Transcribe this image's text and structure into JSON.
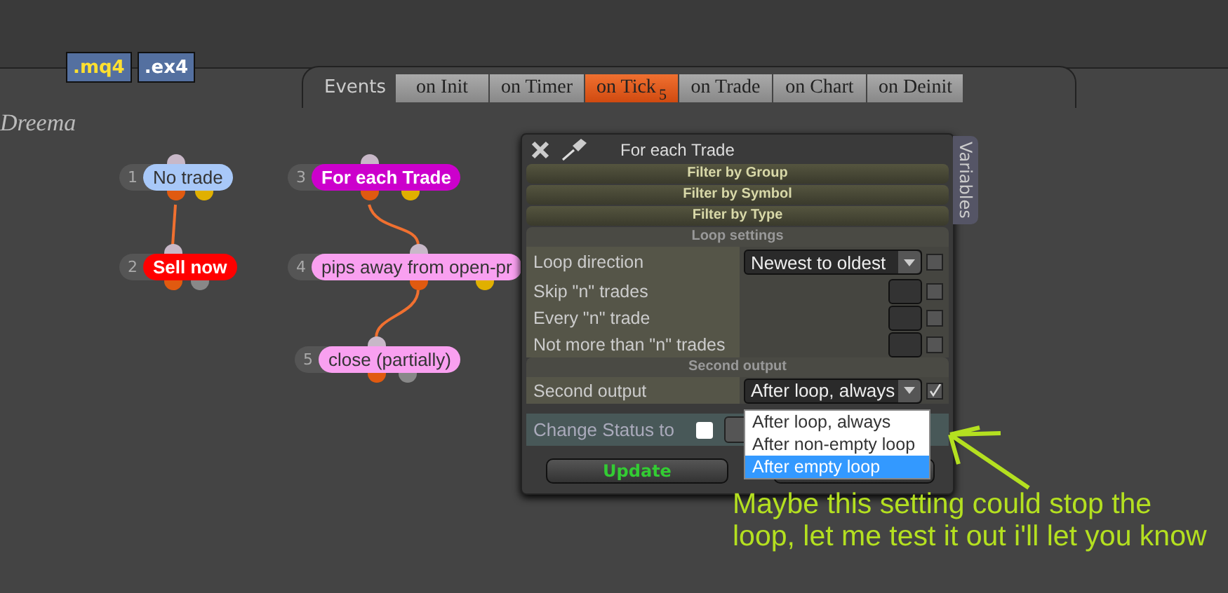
{
  "toolbar": {
    "buttons": [
      {
        "label": ".mq4"
      },
      {
        "label": ".ex4"
      }
    ]
  },
  "events": {
    "label": "Events",
    "tabs": [
      {
        "label": "on Init",
        "selected": false
      },
      {
        "label": "on Timer",
        "selected": false
      },
      {
        "label": "on Tick",
        "badge": "5",
        "selected": true
      },
      {
        "label": "on Trade",
        "selected": false
      },
      {
        "label": "on Chart",
        "selected": false
      },
      {
        "label": "on Deinit",
        "selected": false
      }
    ]
  },
  "logo": "Dreema",
  "nodes": [
    {
      "number": "1",
      "label": "No trade",
      "color": "#a8c8f8",
      "emphasis": false,
      "outputs": [
        {
          "color": "#e05a10"
        },
        {
          "color": "#e0b000"
        }
      ]
    },
    {
      "number": "2",
      "label": "Sell now",
      "color": "#ff0000",
      "emphasis": true,
      "outputs": [
        {
          "color": "#e05a10"
        },
        {
          "color": "#888888"
        }
      ]
    },
    {
      "number": "3",
      "label": "For each Trade",
      "color": "#cc00cc",
      "emphasis": true,
      "outputs": [
        {
          "color": "#e05a10"
        },
        {
          "color": "#e0b000"
        }
      ]
    },
    {
      "number": "4",
      "label": "pips away from open-pr",
      "color": "#f9a0f0",
      "emphasis": false,
      "outputs": [
        {
          "color": "#e05a10"
        },
        {
          "color": "#e0b000"
        }
      ]
    },
    {
      "number": "5",
      "label": "close (partially)",
      "color": "#f9a0f0",
      "emphasis": false,
      "outputs": [
        {
          "color": "#e05a10"
        },
        {
          "color": "#888888"
        }
      ]
    }
  ],
  "dialog": {
    "title": "For each Trade",
    "side_tab": "Variables",
    "filters": [
      "Filter by Group",
      "Filter by Symbol",
      "Filter by Type"
    ],
    "sections": [
      {
        "heading": "Loop settings",
        "rows": [
          {
            "label": "Loop direction",
            "kind": "select",
            "value": "Newest to oldest",
            "checked": false
          },
          {
            "label": "Skip \"n\" trades",
            "kind": "input",
            "checked": false
          },
          {
            "label": "Every \"n\" trade",
            "kind": "input",
            "checked": false
          },
          {
            "label": "Not more than \"n\" trades",
            "kind": "input",
            "checked": false
          }
        ]
      },
      {
        "heading": "Second output",
        "rows": [
          {
            "label": "Second output",
            "kind": "select",
            "value": "After loop, always",
            "checked": true
          }
        ]
      }
    ],
    "status": {
      "label": "Change Status to",
      "checked": false
    },
    "buttons": [
      {
        "label": "Update",
        "kind": "ok"
      },
      {
        "kind": "cancel"
      }
    ],
    "dropdown": {
      "options": [
        {
          "label": "After loop, always",
          "selected": false
        },
        {
          "label": "After non-empty loop",
          "selected": false
        },
        {
          "label": "After empty loop",
          "selected": true
        }
      ]
    }
  },
  "annotation": {
    "text": "Maybe this setting could stop the loop, let me test it out i'll let you know"
  }
}
